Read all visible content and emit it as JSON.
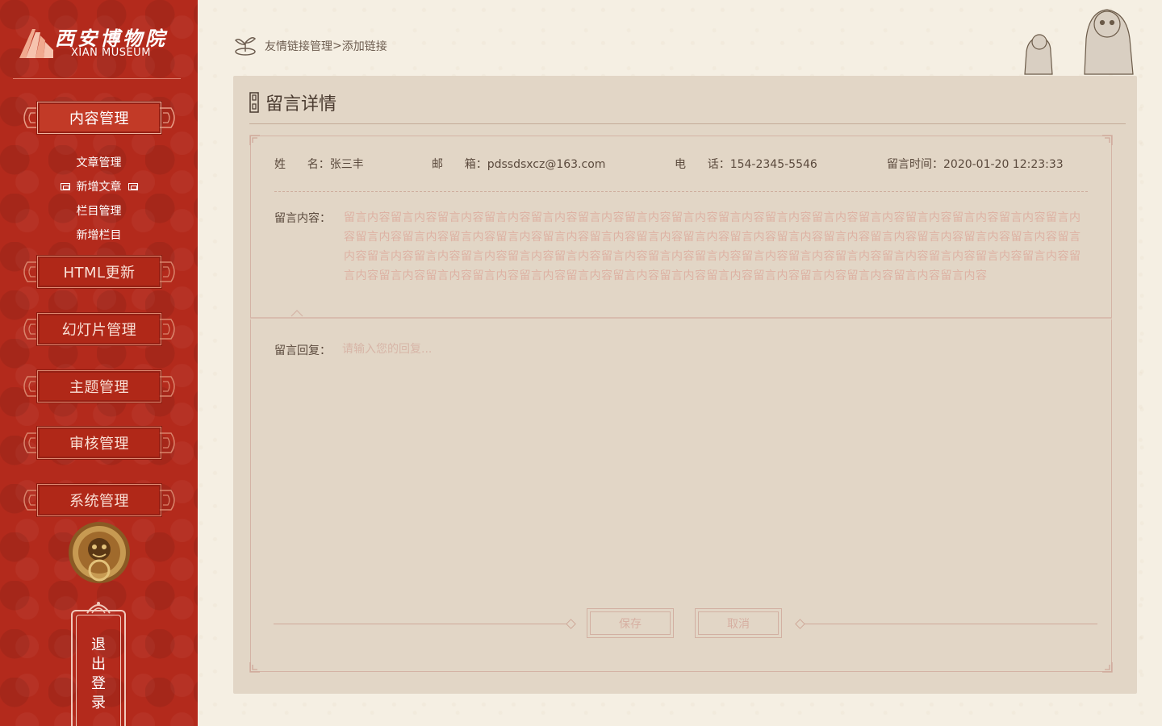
{
  "brand": {
    "name_cn": "西安博物院",
    "name_en": "XIAN MUSEUM"
  },
  "sidebar": {
    "content_mgmt": "内容管理",
    "sub_items": [
      {
        "label": "文章管理",
        "active": false
      },
      {
        "label": "新增文章",
        "active": true
      },
      {
        "label": "栏目管理",
        "active": false
      },
      {
        "label": "新增栏目",
        "active": false
      }
    ],
    "html_update": "HTML更新",
    "slides_mgmt": "幻灯片管理",
    "theme_mgmt": "主题管理",
    "review_mgmt": "审核管理",
    "system_mgmt": "系统管理",
    "logout_chars": [
      "退",
      "出",
      "登",
      "录"
    ]
  },
  "breadcrumb": {
    "parent": "友情链接管理",
    "separator": ">",
    "current": "添加链接"
  },
  "panel": {
    "title": "留言详情",
    "name_key": "姓      名：",
    "name_value": "张三丰",
    "email_key": "邮      箱：",
    "email_value": "pdssdsxcz@163.com",
    "phone_key": "电      话：",
    "phone_value": "154-2345-5546",
    "time_key": "留言时间：",
    "time_value": "2020-01-20 12:23:33",
    "content_key": "留言内容：",
    "content_value": "留言内容留言内容留言内容留言内容留言内容留言内容留言内容留言内容留言内容留言内容留言内容留言内容留言内容留言内容留言内容留言内容留言内容留言内容留言内容留言内容留言内容留言内容留言内容留言内容留言内容留言内容留言内容留言内容留言内容留言内容留言内容留言内容留言内容留言内容留言内容留言内容留言内容留言内容留言内容留言内容留言内容留言内容留言内容留言内容留言内容留言内容留言内容留言内容留言内容留言内容留言内容留言内容留言内容留言内容留言内容留言内容留言内容留言内容留言内容留言内容留言内容",
    "reply_key": "留言回复：",
    "reply_placeholder": "请输入您的回复...",
    "reply_value": "",
    "save_label": "保存",
    "cancel_label": "取消"
  },
  "colors": {
    "sidebar_red": "#b32a1c",
    "panel_bg": "#e2d6c6",
    "accent_pink": "#ddb1a3",
    "text_dark": "#5b4a3d"
  }
}
